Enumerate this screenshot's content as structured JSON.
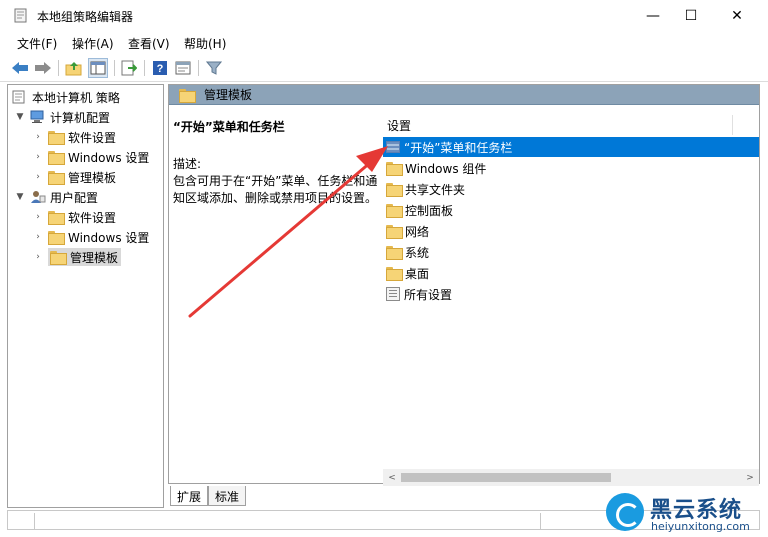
{
  "window": {
    "title": "本地组策略编辑器",
    "min_glyph": "—",
    "max_glyph": "☐",
    "close_glyph": "✕"
  },
  "menu": {
    "file": "文件(F)",
    "action": "操作(A)",
    "view": "查看(V)",
    "help": "帮助(H)"
  },
  "tree": {
    "root": "本地计算机 策略",
    "computer_config": "计算机配置",
    "cc_software": "软件设置",
    "cc_windows": "Windows 设置",
    "cc_admin": "管理模板",
    "user_config": "用户配置",
    "uc_software": "软件设置",
    "uc_windows": "Windows 设置",
    "uc_admin": "管理模板"
  },
  "content": {
    "header": "管理模板",
    "desc_title": "“开始”菜单和任务栏",
    "desc_label": "描述:",
    "desc_text": "包含可用于在“开始”菜单、任务栏和通知区域添加、删除或禁用项目的设置。",
    "column_header": "设置",
    "items": [
      {
        "label": "“开始”菜单和任务栏",
        "icon": "settings-page-icon",
        "selected": true
      },
      {
        "label": "Windows 组件",
        "icon": "folder-icon"
      },
      {
        "label": "共享文件夹",
        "icon": "folder-icon"
      },
      {
        "label": "控制面板",
        "icon": "folder-icon"
      },
      {
        "label": "网络",
        "icon": "folder-icon"
      },
      {
        "label": "系统",
        "icon": "folder-icon"
      },
      {
        "label": "桌面",
        "icon": "folder-icon"
      },
      {
        "label": "所有设置",
        "icon": "all-settings-icon"
      }
    ]
  },
  "tabs": {
    "extended": "扩展",
    "standard": "标准"
  },
  "watermark": {
    "title": "黑云系统",
    "url": "heiyunxitong.com"
  },
  "colors": {
    "selection": "#0078d7",
    "header_bar": "#8ca3b8",
    "annotation_arrow": "#e53935"
  }
}
